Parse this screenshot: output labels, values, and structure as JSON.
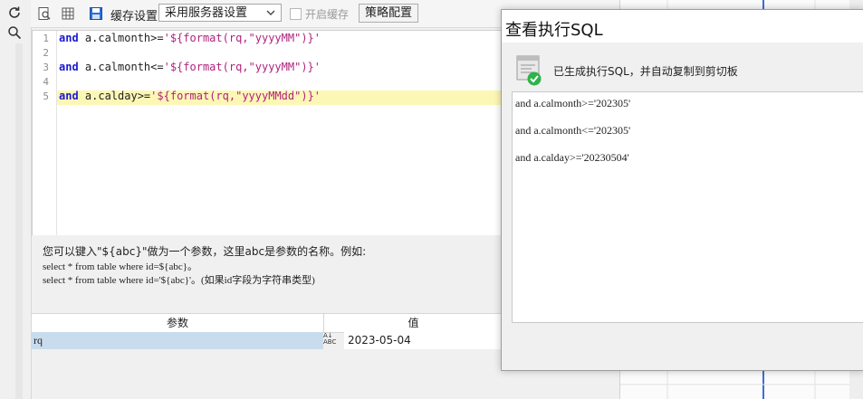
{
  "toolbar": {
    "cache_label": "缓存设置",
    "cache_select_value": "采用服务器设置",
    "enable_cache_label": "开启缓存",
    "policy_button": "策略配置"
  },
  "editor": {
    "lines": [
      {
        "num": "1",
        "kw": "and",
        "code": " a.calmonth>=",
        "str": "'${format(rq,\"yyyyMM\")}'"
      },
      {
        "num": "2",
        "kw": "",
        "code": "",
        "str": ""
      },
      {
        "num": "3",
        "kw": "and",
        "code": " a.calmonth<=",
        "str": "'${format(rq,\"yyyyMM\")}'"
      },
      {
        "num": "4",
        "kw": "",
        "code": "",
        "str": ""
      },
      {
        "num": "5",
        "kw": "and",
        "code": " a.calday>=",
        "str": "'${format(rq,\"yyyyMMdd\")}'"
      }
    ]
  },
  "help": {
    "line1": "您可以键入\"${abc}\"做为一个参数，这里abc是参数的名称。例如:",
    "line2": "select * from table where id=${abc}。",
    "line3": "select * from table where id='${abc}'。(如果id字段为字符串类型)"
  },
  "params": {
    "col_param": "参数",
    "col_value": "值",
    "row_name": "rq",
    "row_value": "2023-05-04",
    "type_icon_top": "A↓",
    "type_icon_bottom": "ABC"
  },
  "dialog": {
    "title": "查看执行SQL",
    "message": "已生成执行SQL，并自动复制到剪切板",
    "sql_lines": [
      "and a.calmonth>='202305'",
      "and a.calmonth<='202305'",
      "and a.calday>='20230504'"
    ]
  },
  "colors": {
    "keyword": "#1b1bd0",
    "string": "#b0227e",
    "highlight_line": "#fdf7b6",
    "selected_cell": "#c9dced",
    "success_green": "#2db34a"
  },
  "icons": [
    "refresh-icon",
    "search-icon",
    "preview-icon",
    "grid-icon",
    "save-icon",
    "dropdown-arrow-icon",
    "success-check-icon"
  ]
}
